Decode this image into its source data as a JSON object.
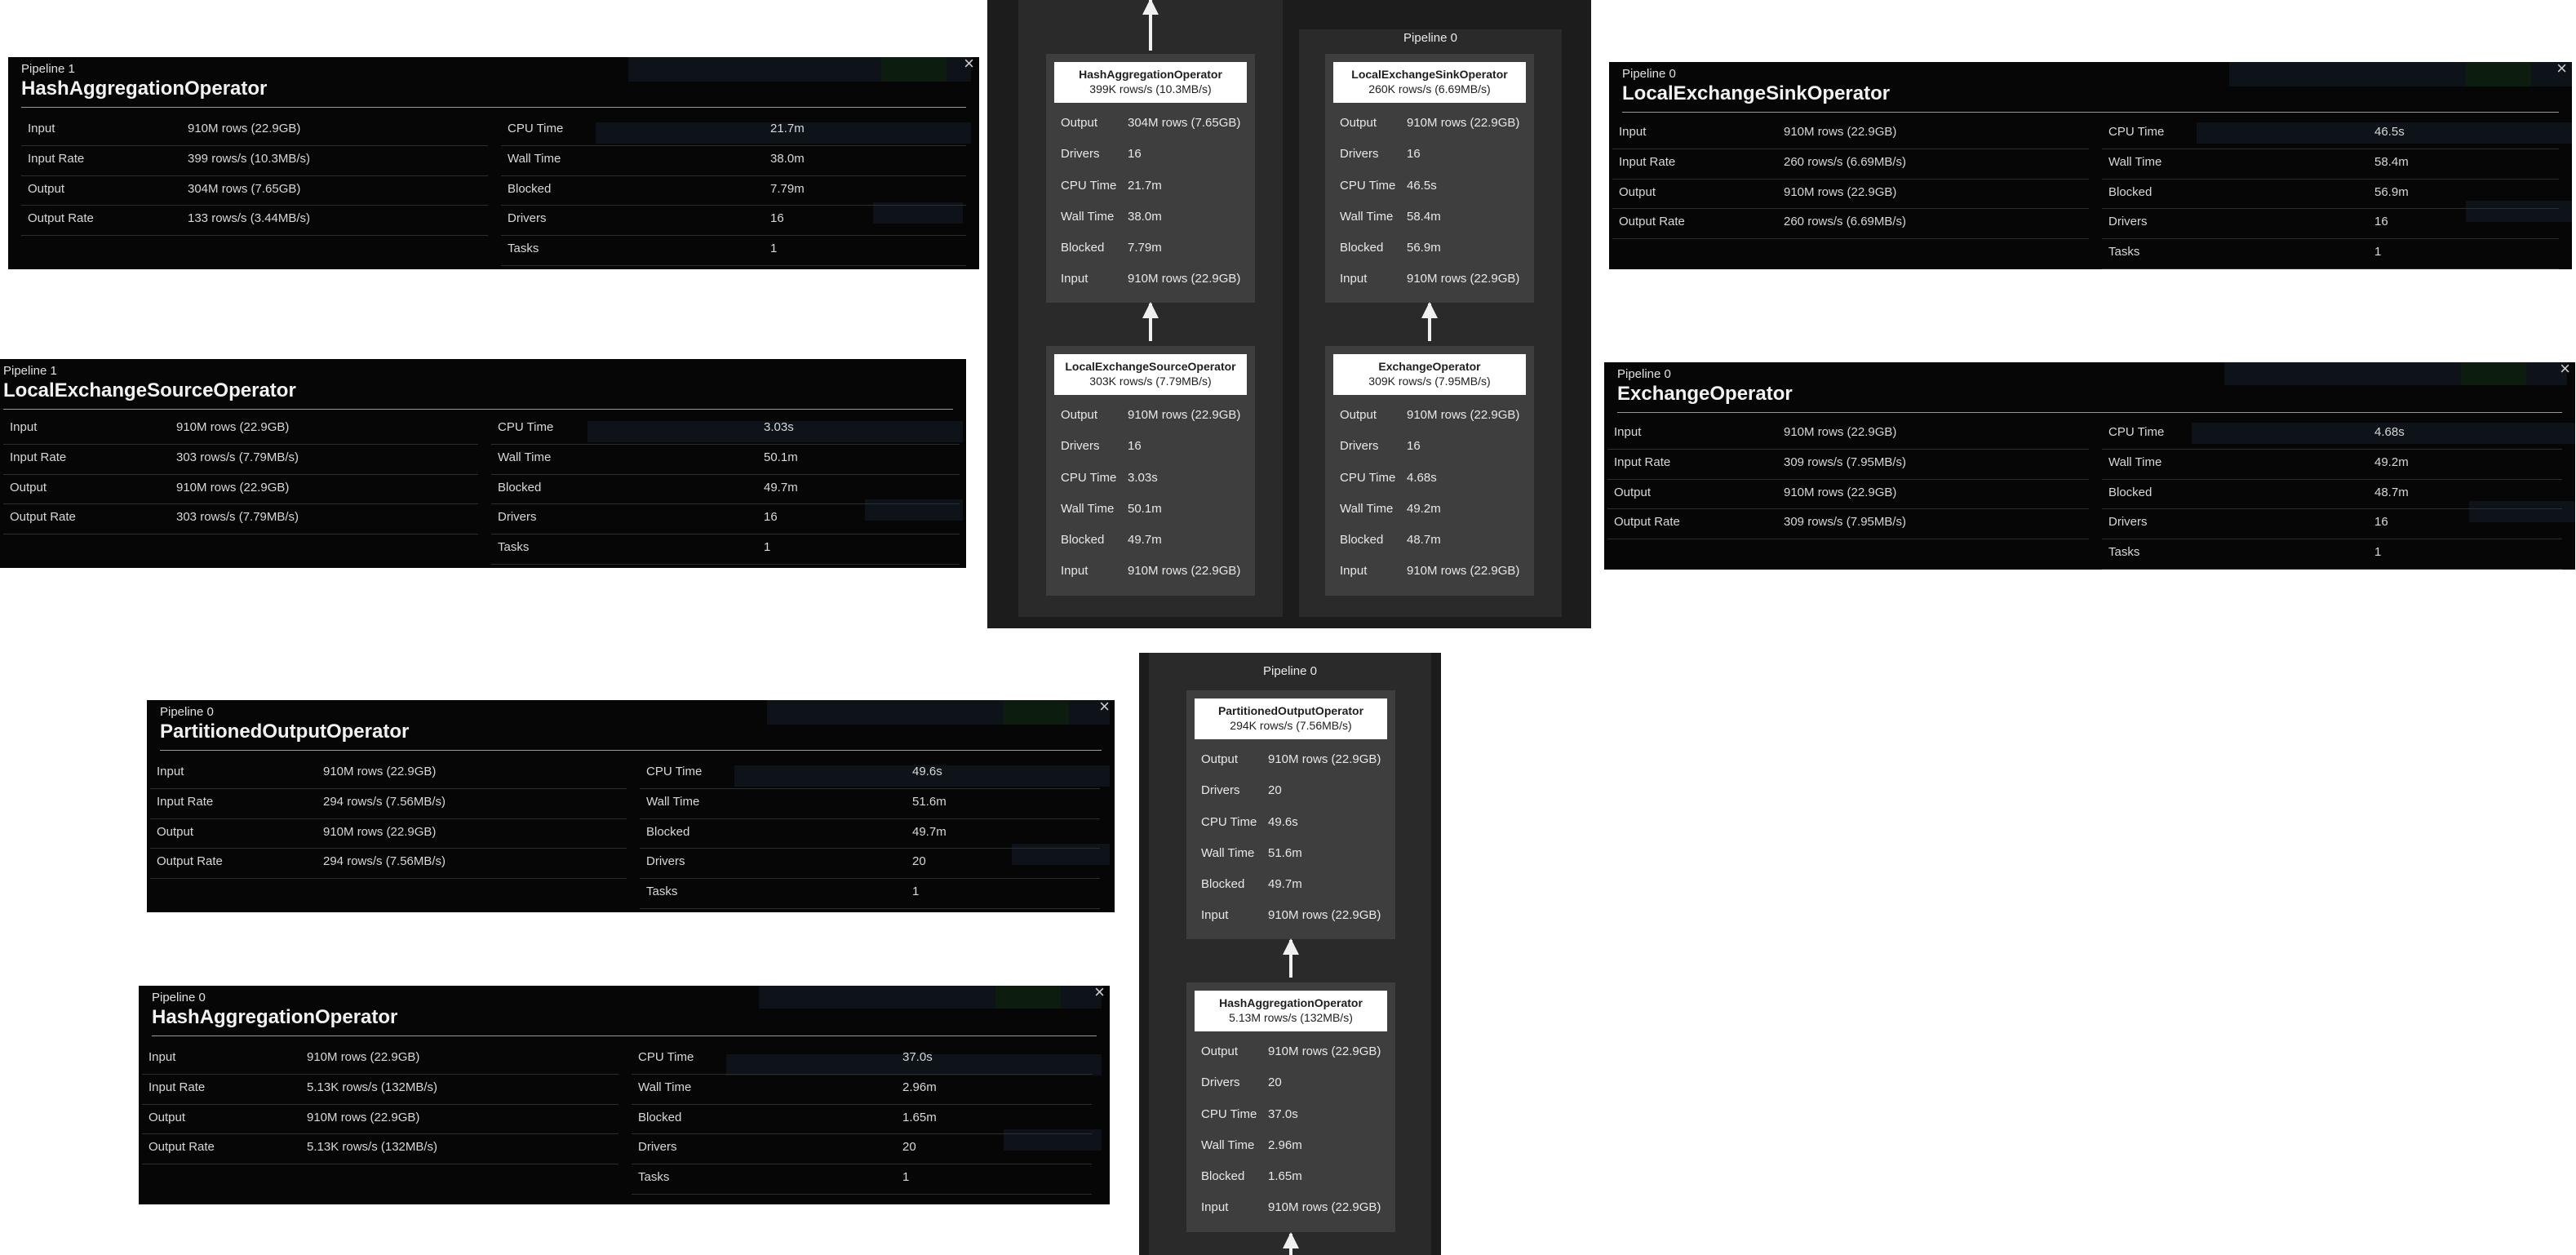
{
  "panels": {
    "p1_hashagg": {
      "pipeline": "Pipeline 1",
      "title": "HashAggregationOperator",
      "left": [
        {
          "k": "Input",
          "v": "910M rows (22.9GB)"
        },
        {
          "k": "Input Rate",
          "v": "399 rows/s (10.3MB/s)"
        },
        {
          "k": "Output",
          "v": "304M rows (7.65GB)"
        },
        {
          "k": "Output Rate",
          "v": "133 rows/s (3.44MB/s)"
        }
      ],
      "right": [
        {
          "k": "CPU Time",
          "v": "21.7m"
        },
        {
          "k": "Wall Time",
          "v": "38.0m"
        },
        {
          "k": "Blocked",
          "v": "7.79m"
        },
        {
          "k": "Drivers",
          "v": "16"
        },
        {
          "k": "Tasks",
          "v": "1"
        }
      ]
    },
    "p1_lxsource": {
      "pipeline": "Pipeline 1",
      "title": "LocalExchangeSourceOperator",
      "left": [
        {
          "k": "Input",
          "v": "910M rows (22.9GB)"
        },
        {
          "k": "Input Rate",
          "v": "303 rows/s (7.79MB/s)"
        },
        {
          "k": "Output",
          "v": "910M rows (22.9GB)"
        },
        {
          "k": "Output Rate",
          "v": "303 rows/s (7.79MB/s)"
        }
      ],
      "right": [
        {
          "k": "CPU Time",
          "v": "3.03s"
        },
        {
          "k": "Wall Time",
          "v": "50.1m"
        },
        {
          "k": "Blocked",
          "v": "49.7m"
        },
        {
          "k": "Drivers",
          "v": "16"
        },
        {
          "k": "Tasks",
          "v": "1"
        }
      ]
    },
    "p0_lxsink": {
      "pipeline": "Pipeline 0",
      "title": "LocalExchangeSinkOperator",
      "left": [
        {
          "k": "Input",
          "v": "910M rows (22.9GB)"
        },
        {
          "k": "Input Rate",
          "v": "260 rows/s (6.69MB/s)"
        },
        {
          "k": "Output",
          "v": "910M rows (22.9GB)"
        },
        {
          "k": "Output Rate",
          "v": "260 rows/s (6.69MB/s)"
        }
      ],
      "right": [
        {
          "k": "CPU Time",
          "v": "46.5s"
        },
        {
          "k": "Wall Time",
          "v": "58.4m"
        },
        {
          "k": "Blocked",
          "v": "56.9m"
        },
        {
          "k": "Drivers",
          "v": "16"
        },
        {
          "k": "Tasks",
          "v": "1"
        }
      ]
    },
    "p0_exchange": {
      "pipeline": "Pipeline 0",
      "title": "ExchangeOperator",
      "left": [
        {
          "k": "Input",
          "v": "910M rows (22.9GB)"
        },
        {
          "k": "Input Rate",
          "v": "309 rows/s (7.95MB/s)"
        },
        {
          "k": "Output",
          "v": "910M rows (22.9GB)"
        },
        {
          "k": "Output Rate",
          "v": "309 rows/s (7.95MB/s)"
        }
      ],
      "right": [
        {
          "k": "CPU Time",
          "v": "4.68s"
        },
        {
          "k": "Wall Time",
          "v": "49.2m"
        },
        {
          "k": "Blocked",
          "v": "48.7m"
        },
        {
          "k": "Drivers",
          "v": "16"
        },
        {
          "k": "Tasks",
          "v": "1"
        }
      ]
    },
    "p0_partout": {
      "pipeline": "Pipeline 0",
      "title": "PartitionedOutputOperator",
      "left": [
        {
          "k": "Input",
          "v": "910M rows (22.9GB)"
        },
        {
          "k": "Input Rate",
          "v": "294 rows/s (7.56MB/s)"
        },
        {
          "k": "Output",
          "v": "910M rows (22.9GB)"
        },
        {
          "k": "Output Rate",
          "v": "294 rows/s (7.56MB/s)"
        }
      ],
      "right": [
        {
          "k": "CPU Time",
          "v": "49.6s"
        },
        {
          "k": "Wall Time",
          "v": "51.6m"
        },
        {
          "k": "Blocked",
          "v": "49.7m"
        },
        {
          "k": "Drivers",
          "v": "20"
        },
        {
          "k": "Tasks",
          "v": "1"
        }
      ]
    },
    "p0_hashagg": {
      "pipeline": "Pipeline 0",
      "title": "HashAggregationOperator",
      "left": [
        {
          "k": "Input",
          "v": "910M rows (22.9GB)"
        },
        {
          "k": "Input Rate",
          "v": "5.13K rows/s (132MB/s)"
        },
        {
          "k": "Output",
          "v": "910M rows (22.9GB)"
        },
        {
          "k": "Output Rate",
          "v": "5.13K rows/s (132MB/s)"
        }
      ],
      "right": [
        {
          "k": "CPU Time",
          "v": "37.0s"
        },
        {
          "k": "Wall Time",
          "v": "2.96m"
        },
        {
          "k": "Blocked",
          "v": "1.65m"
        },
        {
          "k": "Drivers",
          "v": "20"
        },
        {
          "k": "Tasks",
          "v": "1"
        }
      ]
    }
  },
  "graph_top": {
    "pipeline_label": "Pipeline 0",
    "ops": {
      "hashagg": {
        "name": "HashAggregationOperator",
        "rate": "399K rows/s (10.3MB/s)",
        "rows": [
          {
            "k": "Output",
            "v": "304M rows (7.65GB)"
          },
          {
            "k": "Drivers",
            "v": "16"
          },
          {
            "k": "CPU Time",
            "v": "21.7m"
          },
          {
            "k": "Wall Time",
            "v": "38.0m"
          },
          {
            "k": "Blocked",
            "v": "7.79m"
          },
          {
            "k": "Input",
            "v": "910M rows (22.9GB)"
          }
        ]
      },
      "lxsource": {
        "name": "LocalExchangeSourceOperator",
        "rate": "303K rows/s (7.79MB/s)",
        "rows": [
          {
            "k": "Output",
            "v": "910M rows (22.9GB)"
          },
          {
            "k": "Drivers",
            "v": "16"
          },
          {
            "k": "CPU Time",
            "v": "3.03s"
          },
          {
            "k": "Wall Time",
            "v": "50.1m"
          },
          {
            "k": "Blocked",
            "v": "49.7m"
          },
          {
            "k": "Input",
            "v": "910M rows (22.9GB)"
          }
        ]
      },
      "lxsink": {
        "name": "LocalExchangeSinkOperator",
        "rate": "260K rows/s (6.69MB/s)",
        "rows": [
          {
            "k": "Output",
            "v": "910M rows (22.9GB)"
          },
          {
            "k": "Drivers",
            "v": "16"
          },
          {
            "k": "CPU Time",
            "v": "46.5s"
          },
          {
            "k": "Wall Time",
            "v": "58.4m"
          },
          {
            "k": "Blocked",
            "v": "56.9m"
          },
          {
            "k": "Input",
            "v": "910M rows (22.9GB)"
          }
        ]
      },
      "exchange": {
        "name": "ExchangeOperator",
        "rate": "309K rows/s (7.95MB/s)",
        "rows": [
          {
            "k": "Output",
            "v": "910M rows (22.9GB)"
          },
          {
            "k": "Drivers",
            "v": "16"
          },
          {
            "k": "CPU Time",
            "v": "4.68s"
          },
          {
            "k": "Wall Time",
            "v": "49.2m"
          },
          {
            "k": "Blocked",
            "v": "48.7m"
          },
          {
            "k": "Input",
            "v": "910M rows (22.9GB)"
          }
        ]
      }
    }
  },
  "graph_bottom": {
    "pipeline_label": "Pipeline 0",
    "ops": {
      "partout": {
        "name": "PartitionedOutputOperator",
        "rate": "294K rows/s (7.56MB/s)",
        "rows": [
          {
            "k": "Output",
            "v": "910M rows (22.9GB)"
          },
          {
            "k": "Drivers",
            "v": "20"
          },
          {
            "k": "CPU Time",
            "v": "49.6s"
          },
          {
            "k": "Wall Time",
            "v": "51.6m"
          },
          {
            "k": "Blocked",
            "v": "49.7m"
          },
          {
            "k": "Input",
            "v": "910M rows (22.9GB)"
          }
        ]
      },
      "hashagg": {
        "name": "HashAggregationOperator",
        "rate": "5.13M rows/s (132MB/s)",
        "rows": [
          {
            "k": "Output",
            "v": "910M rows (22.9GB)"
          },
          {
            "k": "Drivers",
            "v": "20"
          },
          {
            "k": "CPU Time",
            "v": "37.0s"
          },
          {
            "k": "Wall Time",
            "v": "2.96m"
          },
          {
            "k": "Blocked",
            "v": "1.65m"
          },
          {
            "k": "Input",
            "v": "910M rows (22.9GB)"
          }
        ]
      }
    }
  },
  "ui": {
    "close_glyph": "×"
  }
}
